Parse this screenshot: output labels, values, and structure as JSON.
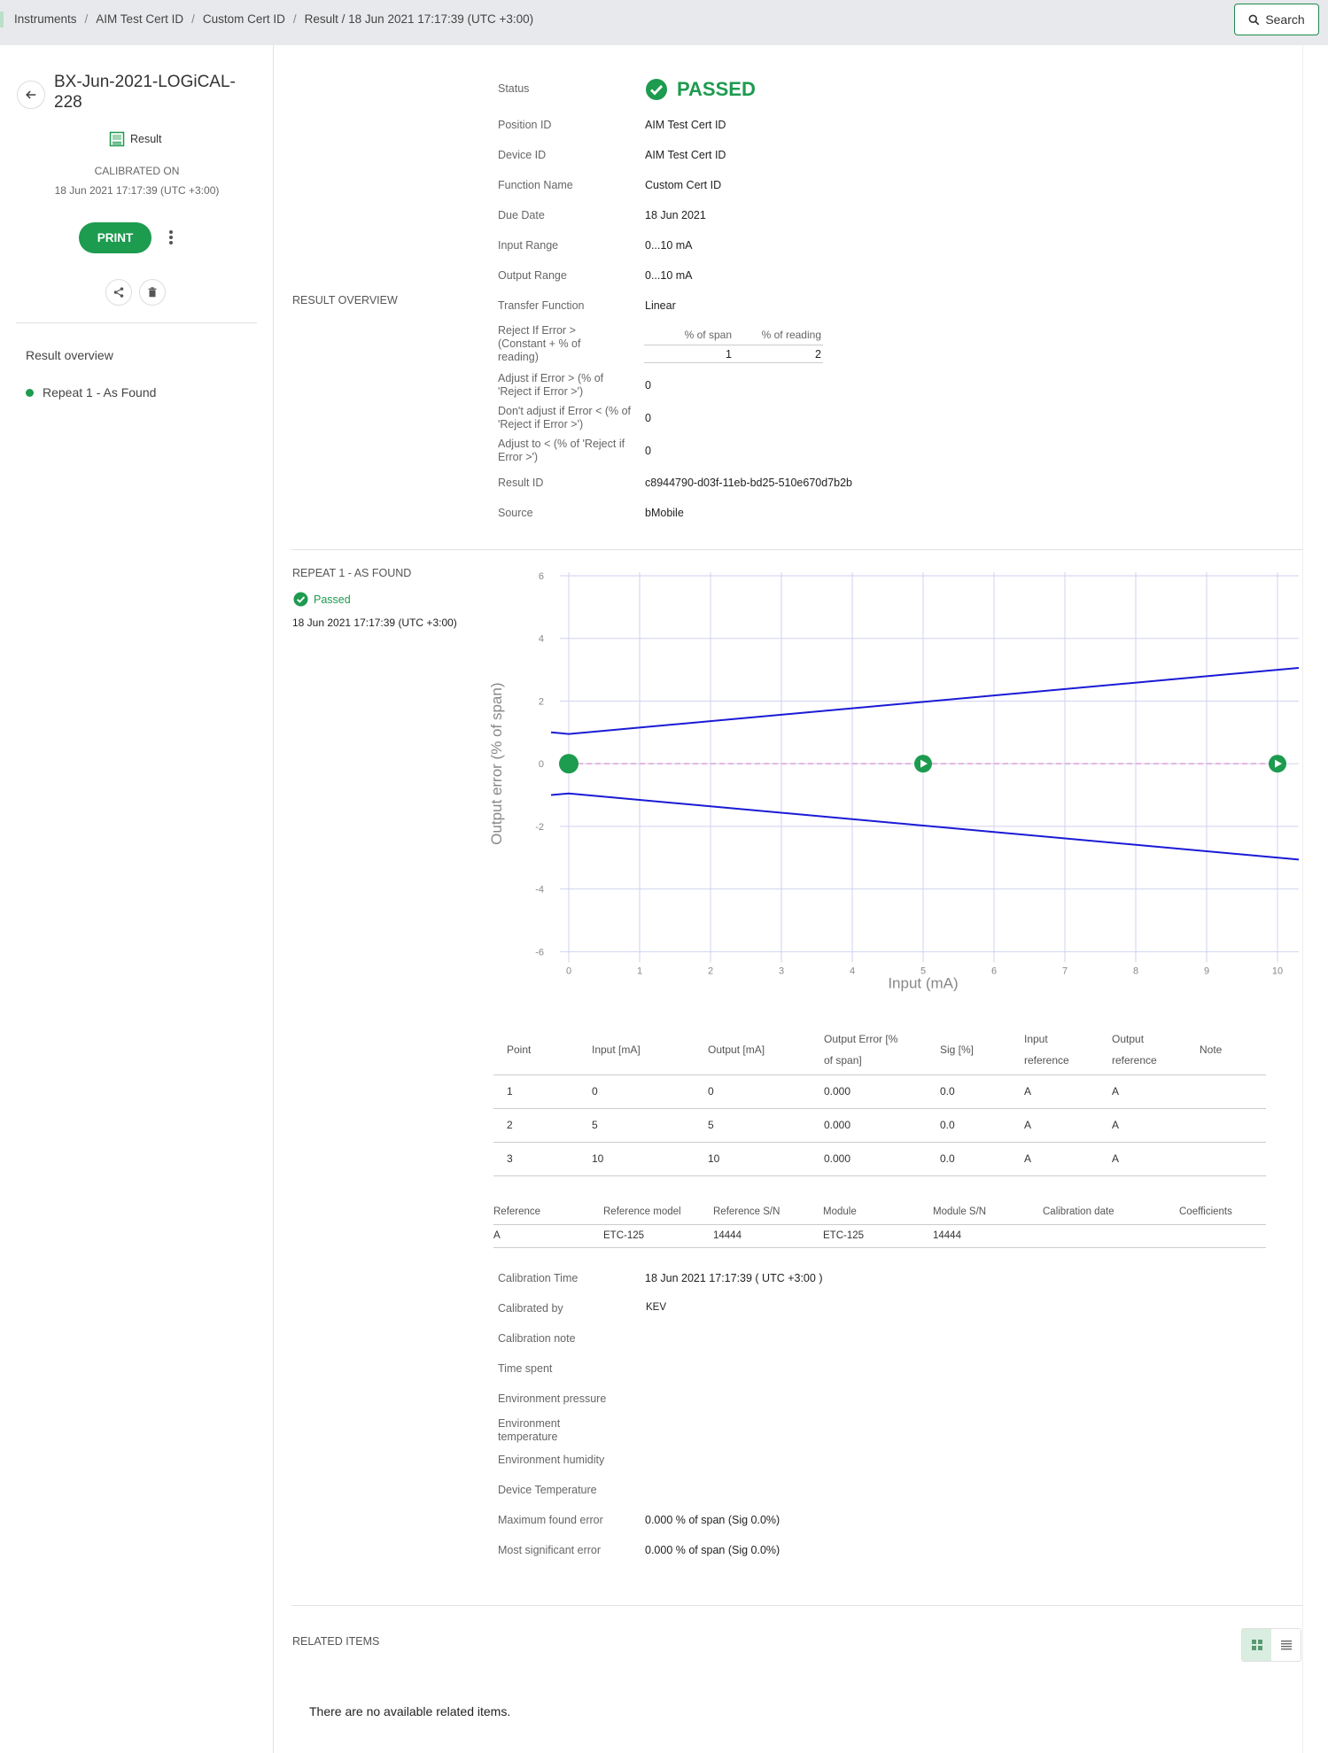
{
  "breadcrumb": {
    "items": [
      "Instruments",
      "AIM Test Cert ID",
      "Custom Cert ID"
    ],
    "current": "Result / 18 Jun 2021 17:17:39 (UTC +3:00)"
  },
  "search": {
    "label": "Search"
  },
  "sidebar": {
    "device_title": "BX-Jun-2021-LOGiCAL-228",
    "result_tag": "Result",
    "calibrated_on_label": "CALIBRATED ON",
    "calibrated_on_value": "18 Jun 2021 17:17:39 (UTC +3:00)",
    "print_label": "PRINT",
    "nav": [
      "Result overview",
      "Repeat 1 - As Found"
    ]
  },
  "overview": {
    "section_label": "RESULT OVERVIEW",
    "status_label": "Status",
    "status_value": "PASSED",
    "rows": [
      {
        "label": "Position ID",
        "value": "AIM Test Cert ID"
      },
      {
        "label": "Device ID",
        "value": "AIM Test Cert ID"
      },
      {
        "label": "Function Name",
        "value": "Custom Cert ID"
      },
      {
        "label": "Due Date",
        "value": "18 Jun 2021"
      },
      {
        "label": "Input Range",
        "value": "0...10 mA"
      },
      {
        "label": "Output Range",
        "value": "0...10 mA"
      },
      {
        "label": "Transfer Function",
        "value": "Linear"
      }
    ],
    "reject_label": "Reject If Error > (Constant + % of reading)",
    "reject_headers": [
      "% of span",
      "% of reading"
    ],
    "reject_values": [
      "1",
      "2"
    ],
    "adjust_rows": [
      {
        "label": "Adjust if Error > (% of 'Reject if Error >')",
        "value": "0"
      },
      {
        "label": "Don't adjust if Error < (% of 'Reject if Error >')",
        "value": "0"
      },
      {
        "label": "Adjust to < (% of 'Reject if Error >')",
        "value": "0"
      }
    ],
    "result_id_label": "Result ID",
    "result_id_value": "c8944790-d03f-11eb-bd25-510e670d7b2b",
    "source_label": "Source",
    "source_value": "bMobile"
  },
  "repeat": {
    "section_label": "REPEAT 1 - AS FOUND",
    "status": "Passed",
    "timestamp": "18 Jun 2021 17:17:39 (UTC +3:00)"
  },
  "chart_data": {
    "type": "line",
    "xlabel": "Input (mA)",
    "ylabel": "Output error (% of span)",
    "xlim": [
      -0.4,
      10.3
    ],
    "ylim": [
      -6.5,
      6
    ],
    "xticks": [
      0,
      1,
      2,
      3,
      4,
      5,
      6,
      7,
      8,
      9,
      10
    ],
    "yticks": [
      6,
      4,
      2,
      0,
      -2,
      -4,
      -6
    ],
    "grid": true,
    "series": [
      {
        "role": "upper-limit",
        "color": "#1a1ad6",
        "x": [
          -0.25,
          0,
          10.3
        ],
        "y": [
          1.0,
          0.95,
          3.06
        ]
      },
      {
        "role": "lower-limit",
        "color": "#1a1ad6",
        "x": [
          -0.25,
          0,
          10.3
        ],
        "y": [
          -1.0,
          -0.95,
          -3.06
        ]
      },
      {
        "role": "zero-line",
        "color": "#e0a0d8",
        "x": [
          0,
          10
        ],
        "y": [
          0,
          0
        ]
      },
      {
        "role": "points",
        "color": "#1d9b4f",
        "x": [
          0,
          5,
          10
        ],
        "y": [
          0,
          0,
          0
        ]
      }
    ]
  },
  "points_table": {
    "headers": [
      "Point",
      "Input [mA]",
      "Output [mA]",
      "Output Error [% of span]",
      "Sig [%]",
      "Input reference",
      "Output reference",
      "Note"
    ],
    "rows": [
      [
        "1",
        "0",
        "0",
        "0.000",
        "0.0",
        "A",
        "A",
        ""
      ],
      [
        "2",
        "5",
        "5",
        "0.000",
        "0.0",
        "A",
        "A",
        ""
      ],
      [
        "3",
        "10",
        "10",
        "0.000",
        "0.0",
        "A",
        "A",
        ""
      ]
    ]
  },
  "reference_table": {
    "headers": [
      "Reference",
      "Reference model",
      "Reference S/N",
      "Module",
      "Module S/N",
      "Calibration date",
      "Coefficients"
    ],
    "rows": [
      [
        "A",
        "ETC-125",
        "14444",
        "ETC-125",
        "14444",
        "",
        ""
      ]
    ]
  },
  "details": [
    {
      "label": "Calibration Time",
      "value": "18 Jun 2021 17:17:39 ( UTC +3:00 )"
    },
    {
      "label": "Calibrated by",
      "value": "KEV"
    },
    {
      "label": "Calibration note",
      "value": ""
    },
    {
      "label": "Time spent",
      "value": ""
    },
    {
      "label": "Environment pressure",
      "value": ""
    },
    {
      "label": "Environment temperature",
      "value": ""
    },
    {
      "label": "Environment humidity",
      "value": ""
    },
    {
      "label": "Device Temperature",
      "value": ""
    },
    {
      "label": "Maximum found error",
      "value": "0.000 % of span (Sig 0.0%)"
    },
    {
      "label": "Most significant error",
      "value": "0.000 % of span (Sig 0.0%)"
    }
  ],
  "related": {
    "section_label": "RELATED ITEMS",
    "empty_text": "There are no available related items."
  },
  "colors": {
    "accent": "#1d9b4f",
    "limit_line": "#1a1ad6"
  }
}
